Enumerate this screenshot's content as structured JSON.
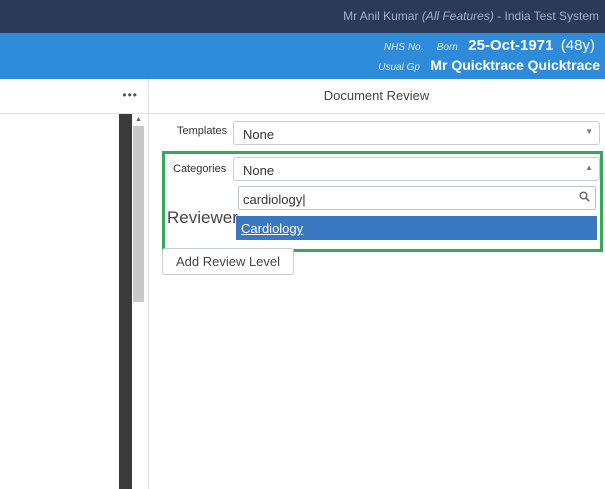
{
  "topbar": {
    "user_name": "Mr Anil Kumar",
    "user_features": "(All Features)",
    "system": " - India Test System"
  },
  "patient": {
    "nhs_label": "NHS No.",
    "born_label": "Born",
    "dob": "25-Oct-1971",
    "age": "(48y)",
    "gp_label": "Usual Gp",
    "gp_name": "Mr Quicktrace Quicktrace"
  },
  "left_panel": {
    "menu_dots": "•••"
  },
  "main": {
    "title": "Document Review",
    "templates": {
      "label": "Templates",
      "value": "None"
    },
    "categories": {
      "label": "Categories",
      "value": "None",
      "search_text": "cardiology|",
      "options": [
        "Cardiology"
      ]
    },
    "reviewer_label": "Reviewer",
    "add_review_level": "Add Review Level"
  },
  "icons": {
    "menu": "more-dots-icon",
    "dropdown": "chevron-down-icon",
    "dropdown_open": "chevron-up-icon",
    "search": "search-icon",
    "scroll_up": "scroll-up-arrow-icon"
  },
  "colors": {
    "topbar": "#2b3b57",
    "patient_banner": "#2d8bd9",
    "highlight_border": "#35a85a",
    "selected_option": "#3a78c4"
  }
}
